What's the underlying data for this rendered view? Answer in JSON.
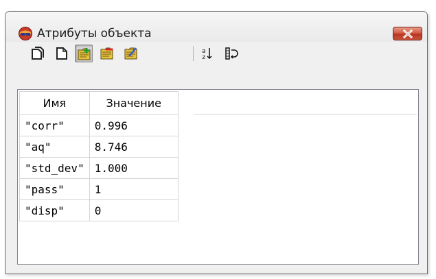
{
  "window": {
    "title": "Атрибуты объекта",
    "close_label": "✕"
  },
  "toolbar": {
    "buttons": [
      {
        "name": "copy-pages-icon",
        "active": false
      },
      {
        "name": "new-page-icon",
        "active": false
      },
      {
        "name": "folder-add-icon",
        "active": true
      },
      {
        "name": "folder-remove-icon",
        "active": false
      },
      {
        "name": "folder-edit-icon",
        "active": false
      },
      {
        "name": "sort-az-icon",
        "active": false
      },
      {
        "name": "list-refresh-icon",
        "active": false
      }
    ]
  },
  "table": {
    "columns": [
      "Имя",
      "Значение"
    ],
    "rows": [
      {
        "name": "\"corr\"",
        "value": "0.996"
      },
      {
        "name": "\"aq\"",
        "value": "8.746"
      },
      {
        "name": "\"std_dev\"",
        "value": "1.000"
      },
      {
        "name": "\"pass\"",
        "value": "1"
      },
      {
        "name": "\"disp\"",
        "value": "0"
      }
    ]
  },
  "colors": {
    "close_button": "#c5543c",
    "window_bg": "#f0f0f0",
    "folder_yellow": "#e8c23a"
  }
}
